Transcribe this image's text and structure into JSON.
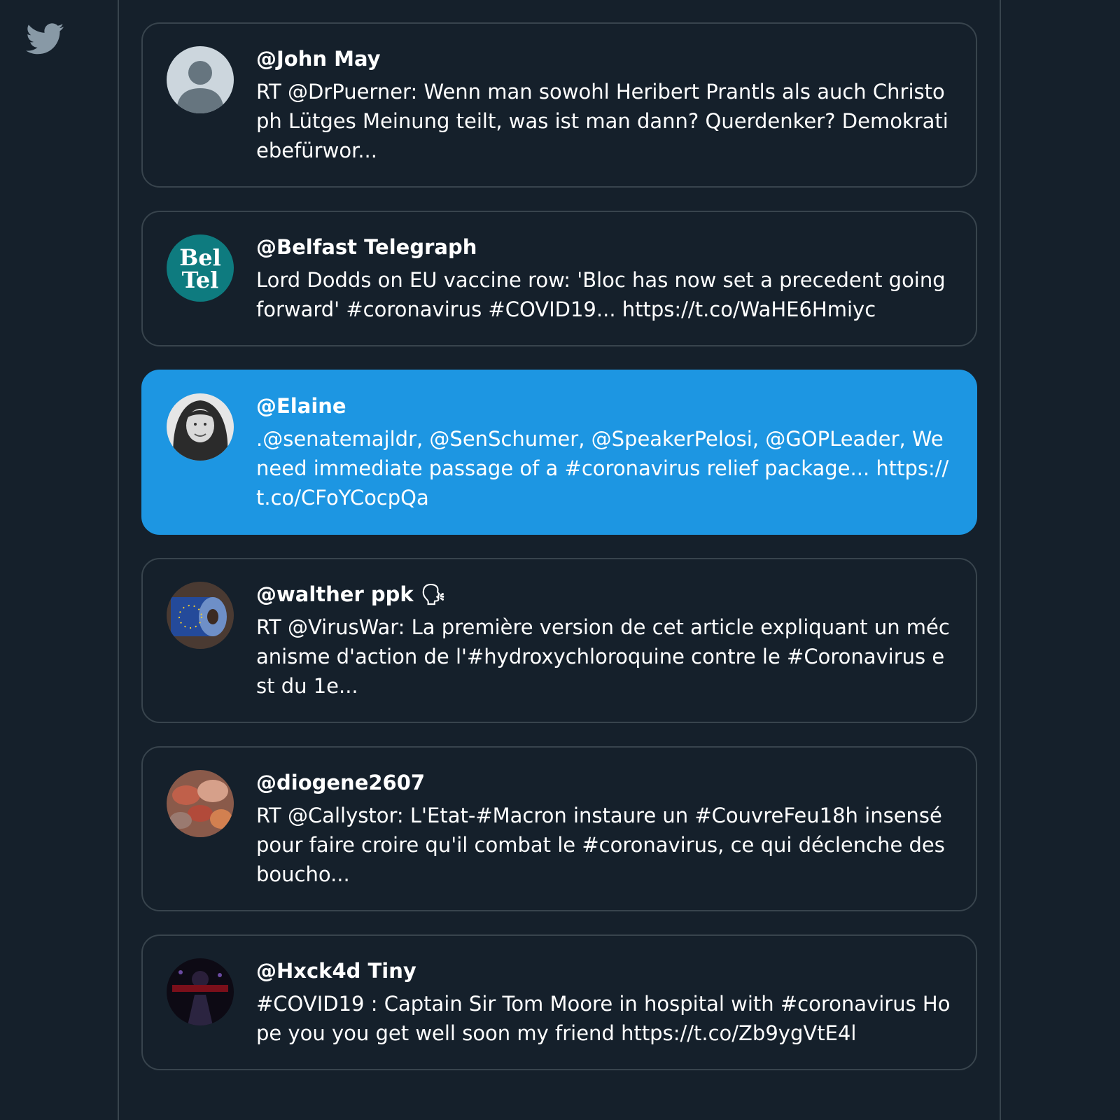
{
  "app": {
    "logo_icon": "twitter-bird-icon",
    "background": "#15202b",
    "border_color": "#38444d",
    "highlight_color": "#1d96e2"
  },
  "tweets": [
    {
      "handle": "@John May",
      "text": "RT @DrPuerner: Wenn man sowohl Heribert Prantls als auch Christoph Lütges Meinung teilt, was ist man dann? Querdenker? Demokratiebefürwor...",
      "avatar_icon": "default-avatar-icon",
      "highlighted": false
    },
    {
      "handle": "@Belfast Telegraph",
      "text": "Lord Dodds on EU vaccine row: 'Bloc has now set a precedent going forward' #coronavirus #COVID19... https://t.co/WaHE6Hmiyc",
      "avatar_icon": "beltel-logo-avatar",
      "avatar_text": [
        "Bel",
        "Tel"
      ],
      "highlighted": false
    },
    {
      "handle": "@Elaine",
      "text": ".@senatemajldr, @SenSchumer, @SpeakerPelosi, @GOPLeader, We need immediate passage of a #coronavirus relief package... https://t.co/CFoYCocpQa",
      "avatar_icon": "portrait-avatar",
      "highlighted": true
    },
    {
      "handle": "@walther ppk 🗣",
      "text": "RT @VirusWar: La première version de cet article expliquant un mécanisme d'action de l'#hydroxychloroquine contre le #Coronavirus est du 1e...",
      "avatar_icon": "eu-toilet-roll-avatar",
      "highlighted": false
    },
    {
      "handle": "@diogene2607",
      "text": "RT @Callystor: L'Etat-#Macron instaure un #CouvreFeu18h insensé pour faire croire qu'il combat le #coronavirus, ce qui déclenche des boucho...",
      "avatar_icon": "stones-avatar",
      "highlighted": false
    },
    {
      "handle": "@Hxck4d Tiny",
      "text": "#COVID19 : Captain Sir Tom Moore in hospital with #coronavirus Hope you you get well soon my friend https://t.co/Zb9ygVtE4l",
      "avatar_icon": "dark-art-avatar",
      "highlighted": false
    }
  ]
}
